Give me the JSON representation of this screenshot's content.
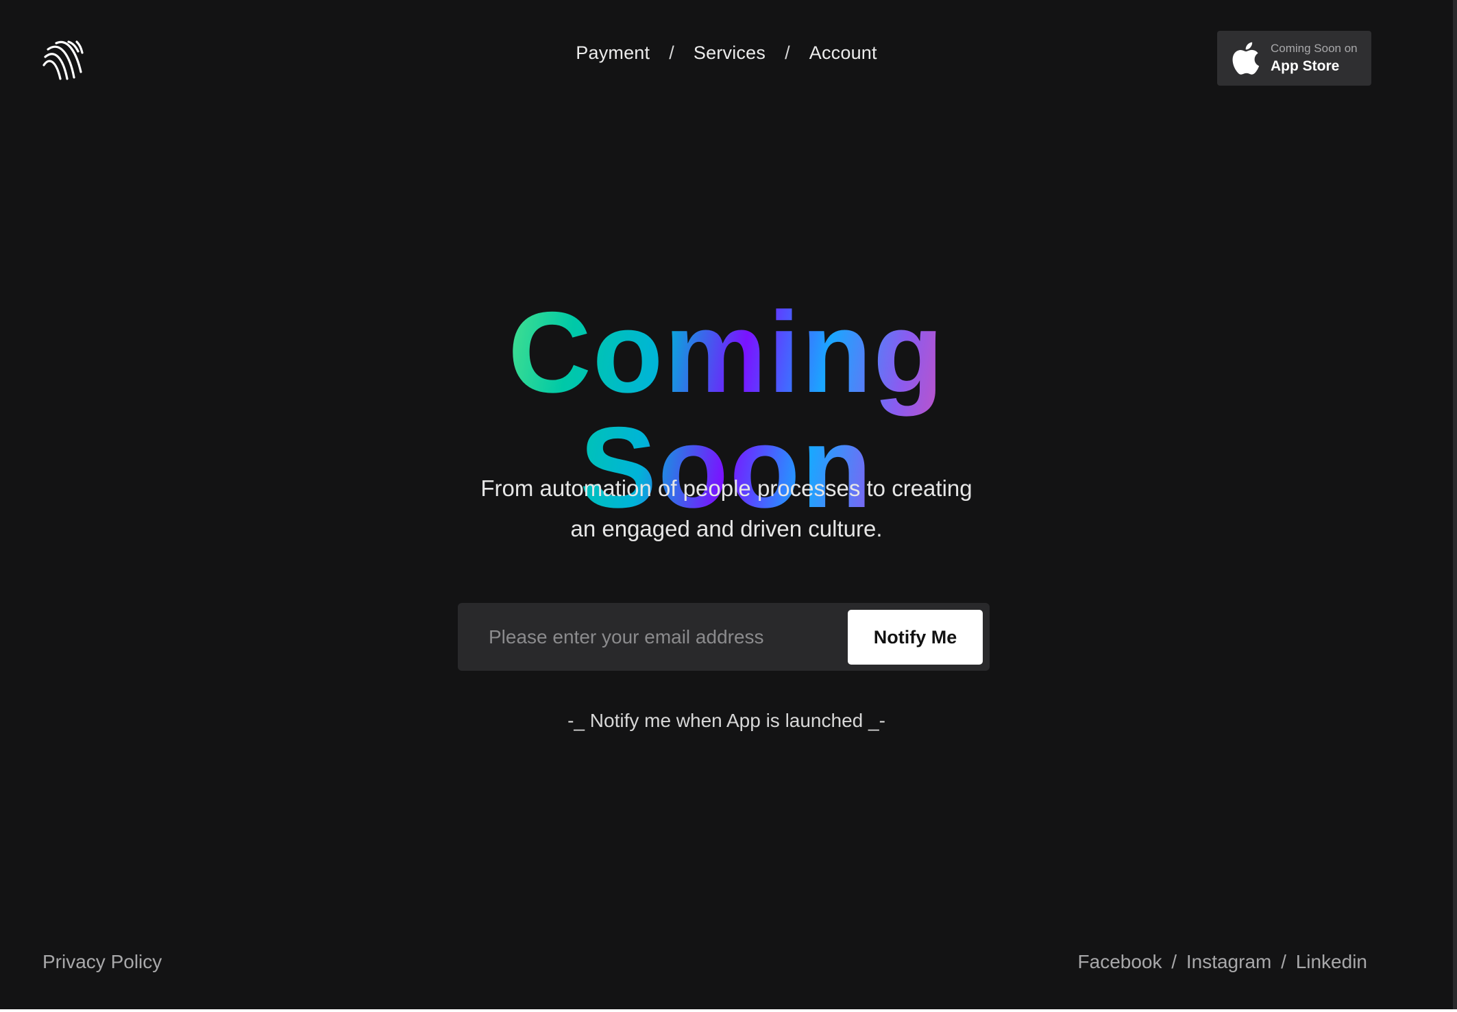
{
  "header": {
    "logo_icon": "waves-logo-icon",
    "nav": [
      {
        "label": "Payment"
      },
      {
        "label": "Services"
      },
      {
        "label": "Account"
      }
    ],
    "nav_separator": "/",
    "app_store": {
      "icon": "apple-icon",
      "small_text": "Coming Soon on",
      "big_text": "App Store"
    }
  },
  "hero": {
    "title": "Coming Soon",
    "subtitle_line1": "From automation of people processes to creating",
    "subtitle_line2": "an engaged and driven culture."
  },
  "form": {
    "email_placeholder": "Please enter your email address",
    "email_value": "",
    "button_label": "Notify Me",
    "hint": "-_ Notify me when App is launched  _-"
  },
  "footer": {
    "privacy": "Privacy Policy",
    "social": [
      {
        "label": "Facebook"
      },
      {
        "label": "Instagram"
      },
      {
        "label": "Linkedin"
      }
    ],
    "social_separator": "/"
  },
  "colors": {
    "background": "#131314",
    "input_background": "#29292b",
    "button_background": "#ffffff",
    "title_gradient": [
      "#a6f460",
      "#00c9a7",
      "#7a13ff",
      "#1aa7ff",
      "#f04aa0",
      "#ff7070"
    ]
  }
}
